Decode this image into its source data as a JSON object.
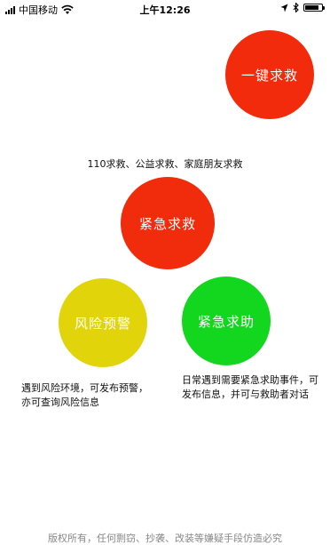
{
  "status_bar": {
    "carrier": "中国移动",
    "time": "上午12:26",
    "battery_level": 0.85
  },
  "main": {
    "one_key_button": "一键求救",
    "emergency_desc": "110求救、公益求救、家庭朋友求救",
    "emergency_button": "紧急求救",
    "risk_button": "风险预警",
    "help_button": "紧急求助",
    "risk_desc": "遇到风险环境，可发布预警，亦可查询风险信息",
    "help_desc": "日常遇到需要紧急求助事件，可发布信息，并可与救助者对话"
  },
  "footer": {
    "copyright": "版权所有，任何剽窃、抄袭、改装等嫌疑手段仿造必究"
  },
  "colors": {
    "one_key": "#f22b0c",
    "emergency": "#f02c0d",
    "risk": "#e1d40a",
    "help": "#12d71e"
  }
}
